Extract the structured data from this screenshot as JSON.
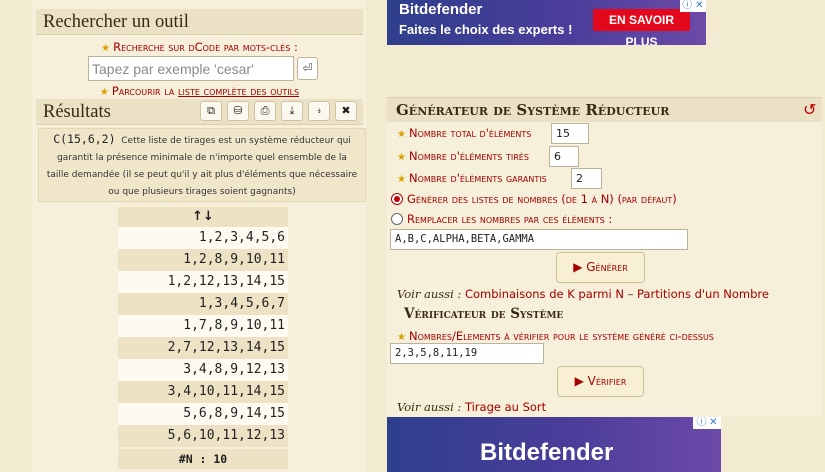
{
  "search": {
    "title": "Rechercher un outil",
    "label": "Recherche sur dCode par mots-clés :",
    "placeholder": "Tapez par exemple 'cesar'",
    "browse_prefix": "Parcourir la ",
    "browse_link": "liste complète des outils"
  },
  "results": {
    "title": "Résultats",
    "toolbar_icons": [
      "copy-icon",
      "save-icon",
      "print-icon",
      "download-icon",
      "pin-icon",
      "close-icon"
    ],
    "desc_code": "C(15,6,2)",
    "description": "Cette liste de tirages est un système réducteur qui garantit la présence minimale de n'importe quel ensemble de la taille demandée (il se peut qu'il y ait plus d'éléments que nécessaire ou que plusieurs tirages soient gagnants)",
    "sort_header": "↑↓",
    "rows": [
      "1,2,3,4,5,6",
      "1,2,8,9,10,11",
      "1,2,12,13,14,15",
      "1,3,4,5,6,7",
      "1,7,8,9,10,11",
      "2,7,12,13,14,15",
      "3,4,8,9,12,13",
      "3,4,10,11,14,15",
      "5,6,8,9,14,15",
      "5,6,10,11,12,13"
    ],
    "footer": "#N : 10"
  },
  "ads": {
    "top": {
      "brand": "Bitdefender",
      "tagline": "Faites le choix des experts !",
      "cta": "EN SAVOIR PLUS"
    },
    "bottom": {
      "brand": "Bitdefender"
    },
    "close": "ⓘ ✕"
  },
  "generator": {
    "title": "Générateur de Système Réducteur",
    "total_label": "Nombre total d'éléments",
    "total_value": "15",
    "drawn_label": "Nombre d'éléments tirés",
    "drawn_value": "6",
    "guaranteed_label": "Nombre d'éléments garantis",
    "guaranteed_value": "2",
    "radio_generate": "Générer des listes de nombres (de 1 à N) (par défaut)",
    "radio_replace": "Remplacer les nombres par ces éléments :",
    "elements_value": "A,B,C,ALPHA,BETA,GAMMA",
    "generate_button": "▶ Générer",
    "see_also_label": "Voir aussi :",
    "see_also_links": [
      "Combinaisons de K parmi N",
      "Partitions d'un Nombre"
    ],
    "see_also_sep": " – "
  },
  "verifier": {
    "title": "Vérificateur de Système",
    "label": "Nombres/Elements à vérifier pour le système généré ci-dessus",
    "value": "2,3,5,8,11,19",
    "verify_button": "▶ Vérifier",
    "see_also_label": "Voir aussi :",
    "see_also_link": "Tirage au Sort"
  }
}
